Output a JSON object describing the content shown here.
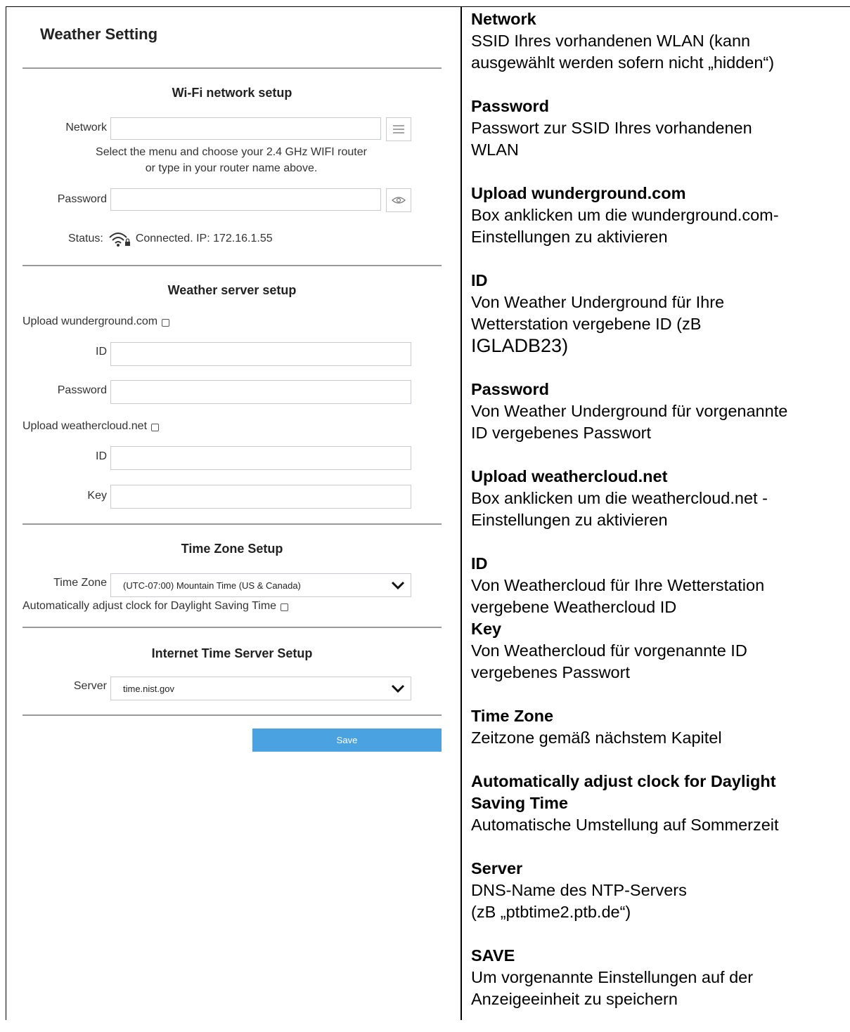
{
  "ui": {
    "title": "Weather Setting",
    "wifi": {
      "section_title": "Wi-Fi network setup",
      "network_label": "Network",
      "network_value": "",
      "hint_line1": "Select the menu and choose your 2.4 GHz WIFI router",
      "hint_line2": "or type in your router name above.",
      "password_label": "Password",
      "password_value": "",
      "status_label": "Status:",
      "status_text": "Connected. IP: 172.16.1.55"
    },
    "weather": {
      "section_title": "Weather server setup",
      "wu_checkbox_label": "Upload wunderground.com",
      "wu_id_label": "ID",
      "wu_password_label": "Password",
      "wc_checkbox_label": "Upload weathercloud.net",
      "wc_id_label": "ID",
      "wc_key_label": "Key"
    },
    "timezone": {
      "section_title": "Time Zone Setup",
      "label": "Time Zone",
      "selected": "(UTC-07:00) Mountain Time (US & Canada)",
      "dst_label": "Automatically adjust clock for Daylight Saving Time"
    },
    "ntp": {
      "section_title": "Internet Time Server Setup",
      "label": "Server",
      "selected": "time.nist.gov"
    },
    "save_label": "Save"
  },
  "docs": {
    "network_h": "Network",
    "network_t1": "SSID Ihres vorhandenen WLAN (kann",
    "network_t2": "ausgewählt werden sofern nicht „hidden“)",
    "password_h": "Password",
    "password_t1": "Passwort zur SSID Ihres vorhandenen",
    "password_t2": "WLAN",
    "wu_h": "Upload wunderground.com",
    "wu_t1": "Box anklicken um die wunderground.com-",
    "wu_t2": "Einstellungen zu aktivieren",
    "id_h": "ID",
    "id_t1": "Von Weather Underground für Ihre",
    "id_t2": "Wetterstation vergebene ID (zB",
    "id_t3": "IGLADB23)",
    "wupw_h": "Password",
    "wupw_t1": "Von Weather Underground für vorgenannte",
    "wupw_t2": "ID vergebenes Passwort",
    "wc_h": "Upload weathercloud.net",
    "wc_t1": "Box anklicken um die weathercloud.net -",
    "wc_t2": "Einstellungen zu aktivieren",
    "wcid_h": "ID",
    "wcid_t1": "Von Weathercloud für Ihre Wetterstation",
    "wcid_t2": "vergebene Weathercloud ID",
    "key_h": "Key",
    "key_t1": "Von Weathercloud für vorgenannte ID",
    "key_t2": "vergebenes Passwort",
    "tz_h": "Time Zone",
    "tz_t1": "Zeitzone gemäß nächstem Kapitel",
    "dst_h1": "Automatically adjust clock for Daylight",
    "dst_h2": "Saving Time",
    "dst_t1": "Automatische Umstellung auf Sommerzeit",
    "srv_h": "Server",
    "srv_t1": "DNS-Name des NTP-Servers",
    "srv_t2": "(zB „ptbtime2.ptb.de“)",
    "save_h": "SAVE",
    "save_t1": "Um vorgenannte Einstellungen auf der",
    "save_t2": "Anzeigeeinheit zu speichern"
  }
}
